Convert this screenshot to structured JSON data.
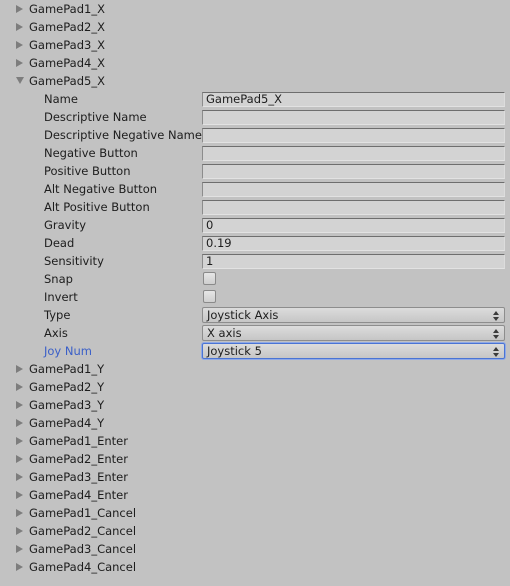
{
  "theme": {
    "background": "#c2c2c2",
    "field_background": "#d3d3d3",
    "label_color": "#1d1d1d",
    "modified_label_color": "#3a5fc8",
    "focus_border_color": "#4a74d4",
    "foldout_arrow_color": "#7d7d7d"
  },
  "axes_before": [
    {
      "label": "GamePad1_X",
      "expanded": false
    },
    {
      "label": "GamePad2_X",
      "expanded": false
    },
    {
      "label": "GamePad3_X",
      "expanded": false
    },
    {
      "label": "GamePad4_X",
      "expanded": false
    }
  ],
  "selected_axis": {
    "label": "GamePad5_X",
    "expanded": true,
    "properties": [
      {
        "label": "Name",
        "kind": "text",
        "value": "GamePad5_X",
        "modified": false
      },
      {
        "label": "Descriptive Name",
        "kind": "text",
        "value": "",
        "modified": false
      },
      {
        "label": "Descriptive Negative Name",
        "kind": "text",
        "value": "",
        "modified": false
      },
      {
        "label": "Negative Button",
        "kind": "text",
        "value": "",
        "modified": false
      },
      {
        "label": "Positive Button",
        "kind": "text",
        "value": "",
        "modified": false
      },
      {
        "label": "Alt Negative Button",
        "kind": "text",
        "value": "",
        "modified": false
      },
      {
        "label": "Alt Positive Button",
        "kind": "text",
        "value": "",
        "modified": false
      },
      {
        "label": "Gravity",
        "kind": "text",
        "value": "0",
        "modified": false
      },
      {
        "label": "Dead",
        "kind": "text",
        "value": "0.19",
        "modified": false
      },
      {
        "label": "Sensitivity",
        "kind": "text",
        "value": "1",
        "modified": false
      },
      {
        "label": "Snap",
        "kind": "checkbox",
        "value": false,
        "modified": false
      },
      {
        "label": "Invert",
        "kind": "checkbox",
        "value": false,
        "modified": false
      },
      {
        "label": "Type",
        "kind": "dropdown",
        "value": "Joystick Axis",
        "modified": false,
        "focused": false
      },
      {
        "label": "Axis",
        "kind": "dropdown",
        "value": "X axis",
        "modified": false,
        "focused": false
      },
      {
        "label": "Joy Num",
        "kind": "dropdown",
        "value": "Joystick 5",
        "modified": true,
        "focused": true
      }
    ]
  },
  "axes_after": [
    {
      "label": "GamePad1_Y",
      "expanded": false
    },
    {
      "label": "GamePad2_Y",
      "expanded": false
    },
    {
      "label": "GamePad3_Y",
      "expanded": false
    },
    {
      "label": "GamePad4_Y",
      "expanded": false
    },
    {
      "label": "GamePad1_Enter",
      "expanded": false
    },
    {
      "label": "GamePad2_Enter",
      "expanded": false
    },
    {
      "label": "GamePad3_Enter",
      "expanded": false
    },
    {
      "label": "GamePad4_Enter",
      "expanded": false
    },
    {
      "label": "GamePad1_Cancel",
      "expanded": false
    },
    {
      "label": "GamePad2_Cancel",
      "expanded": false
    },
    {
      "label": "GamePad3_Cancel",
      "expanded": false
    },
    {
      "label": "GamePad4_Cancel",
      "expanded": false
    }
  ],
  "icons": {
    "foldout_collapsed": "triangle-right-icon",
    "foldout_expanded": "triangle-down-icon",
    "dropdown_stepper": "stepper-updown-icon"
  }
}
